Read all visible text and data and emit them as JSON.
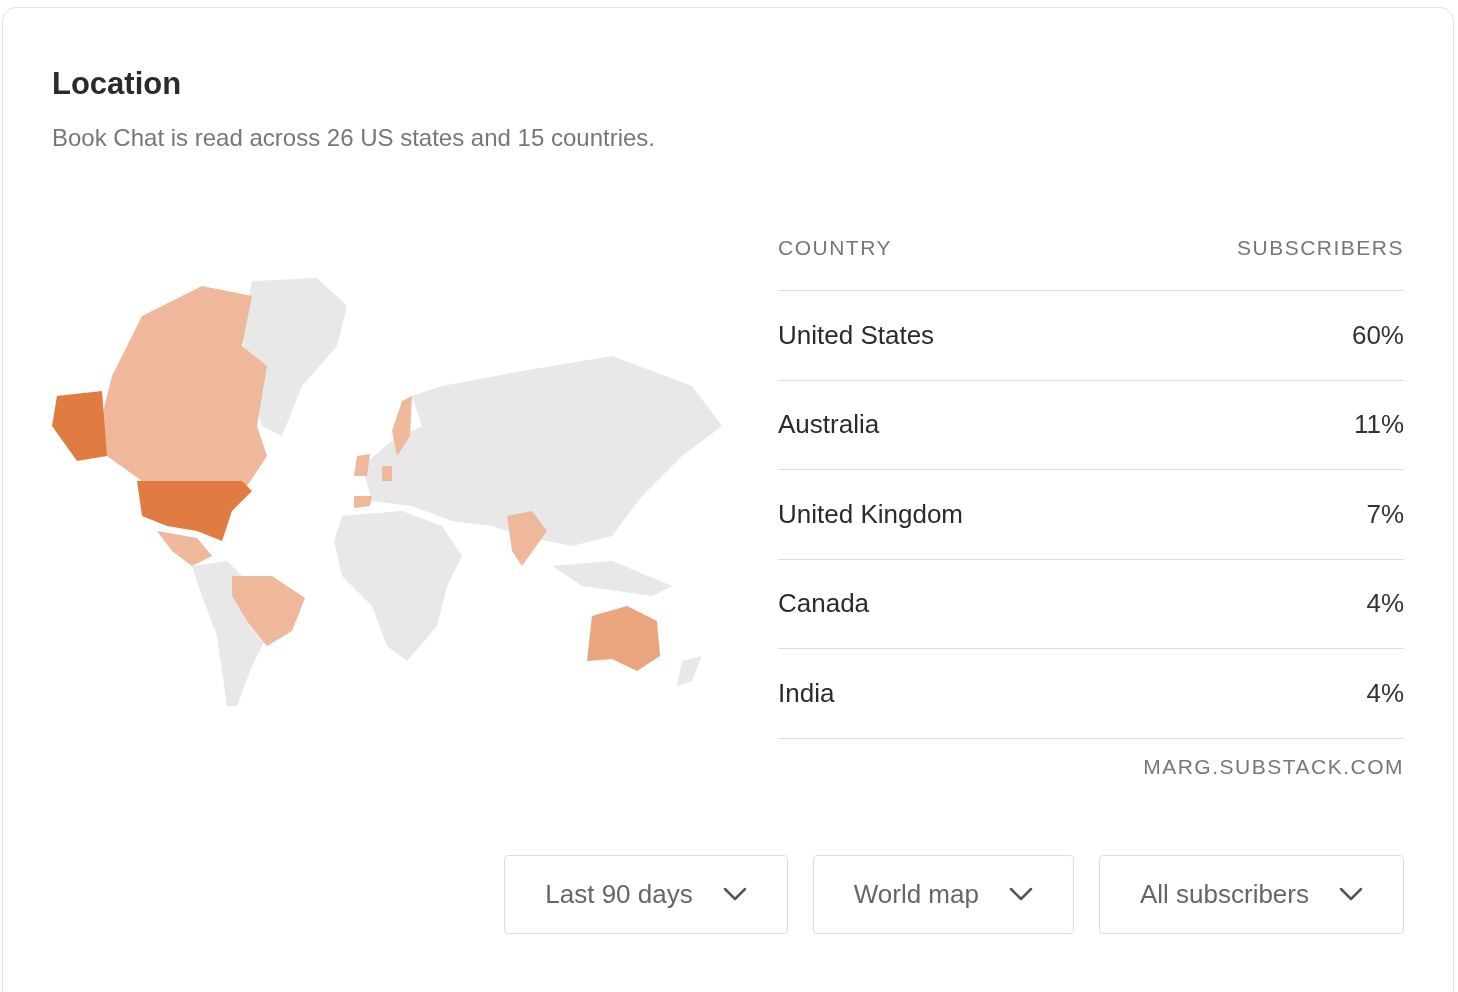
{
  "title": "Location",
  "subtitle": "Book Chat is read across 26 US states and 15 countries.",
  "table": {
    "columns": [
      "COUNTRY",
      "SUBSCRIBERS"
    ],
    "rows": [
      {
        "country": "United States",
        "share": "60%"
      },
      {
        "country": "Australia",
        "share": "11%"
      },
      {
        "country": "United Kingdom",
        "share": "7%"
      },
      {
        "country": "Canada",
        "share": "4%"
      },
      {
        "country": "India",
        "share": "4%"
      }
    ],
    "source": "MARG.SUBSTACK.COM"
  },
  "dropdowns": [
    "Last 90 days",
    "World map",
    "All subscribers"
  ]
}
